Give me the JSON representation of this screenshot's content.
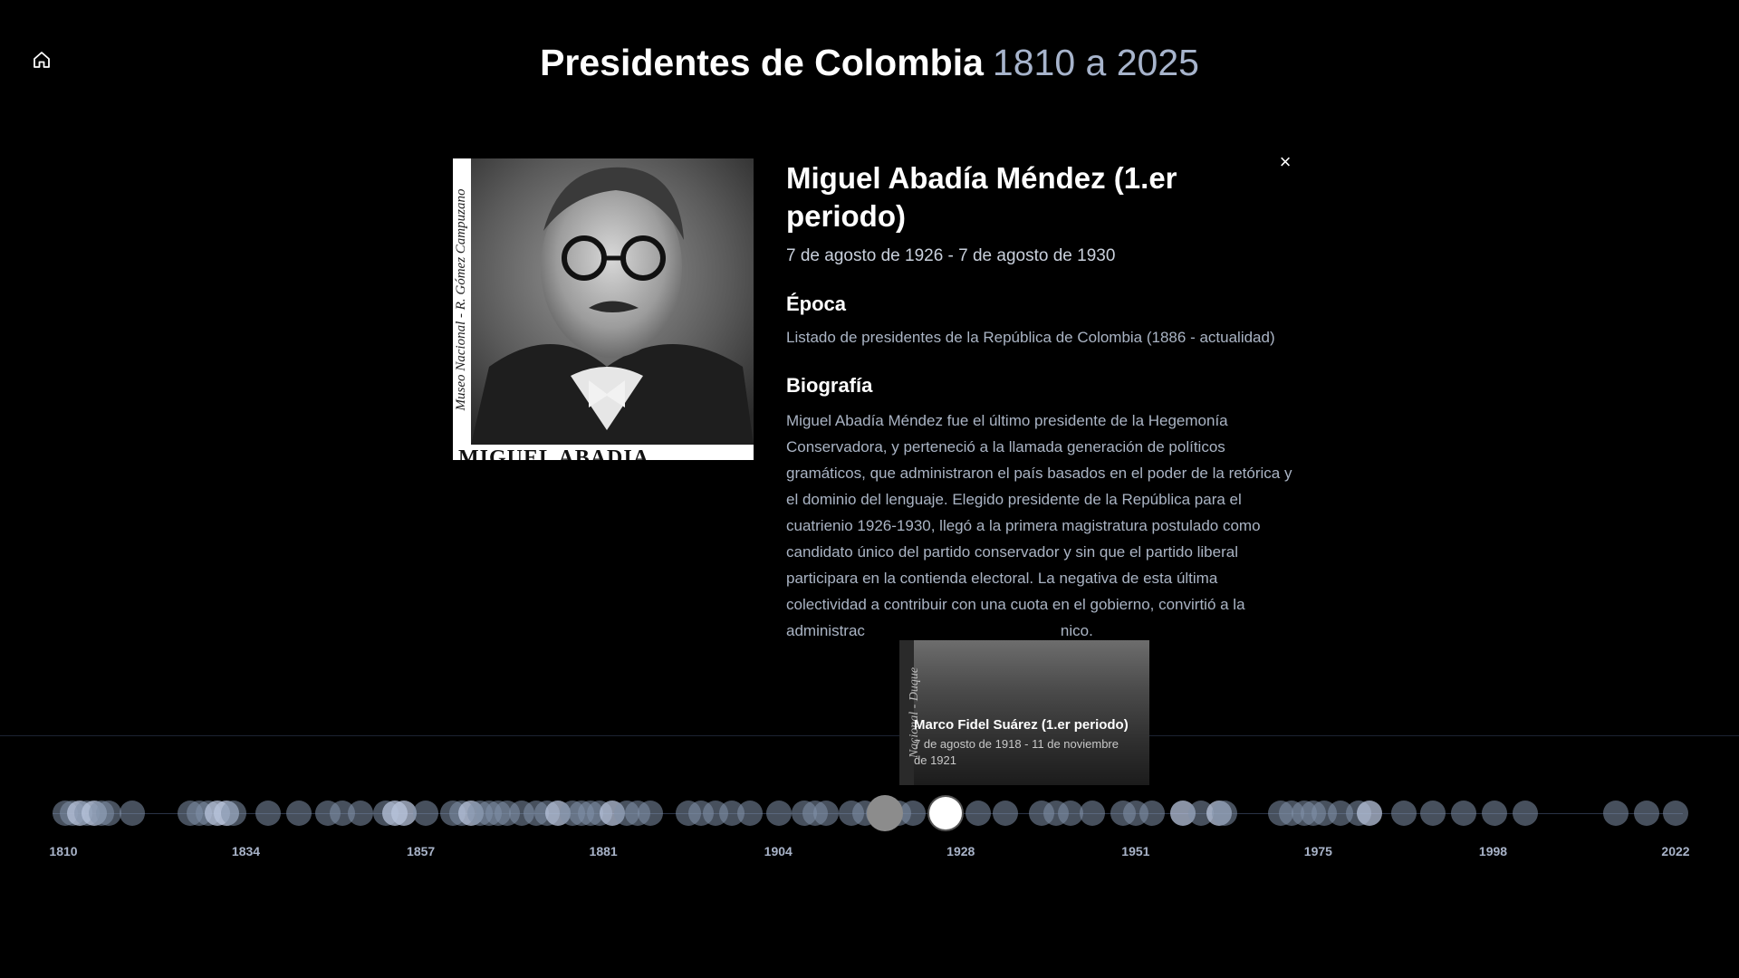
{
  "header": {
    "title_main": "Presidentes de Colombia",
    "title_range": "1810 a 2025",
    "home_icon": "home-icon"
  },
  "detail": {
    "name": "Miguel Abadía Méndez (1.er periodo)",
    "dates": "7 de agosto de 1926 - 7 de agosto de 1930",
    "portrait_side_caption": "Museo Nacional - R. Gómez Campuzano",
    "portrait_plate": "MIGUEL ABADIA",
    "close_icon": "close-icon",
    "epoca_heading": "Época",
    "epoca_text": "Listado de presidentes de la República de Colombia (1886 - actualidad)",
    "bio_heading": "Biografía",
    "bio_text": "Miguel Abadía Méndez fue el último presidente de la Hegemonía Conservadora, y perteneció a la llamada generación de políticos gramáticos, que administraron el país basados en el poder de la retórica y el dominio del lenguaje. Elegido presidente de la República para el cuatrienio 1926-1930, llegó a la primera magistratura postulado como candidato único del partido conservador y sin que el partido liberal participara en la contienda electoral. La negativa de esta última colectividad a contribuir con una cuota en el gobierno, convirtió a la administrac",
    "bio_tail": "nico."
  },
  "preview": {
    "name": "Marco Fidel Suárez (1.er periodo)",
    "dates": "7 de agosto de 1918 - 11 de noviembre de 1921",
    "side_caption": "Nacional - Duque"
  },
  "timeline": {
    "ticks": [
      "1810",
      "1834",
      "1857",
      "1881",
      "1904",
      "1928",
      "1951",
      "1975",
      "1998",
      "2022"
    ],
    "selected_year": 1926,
    "hovered_year": 1918,
    "colors": {
      "dot": "#8291aa",
      "dot_highlight": "#b8c4dc",
      "selected": "#ffffff",
      "hovered": "#8c8c8c"
    }
  }
}
